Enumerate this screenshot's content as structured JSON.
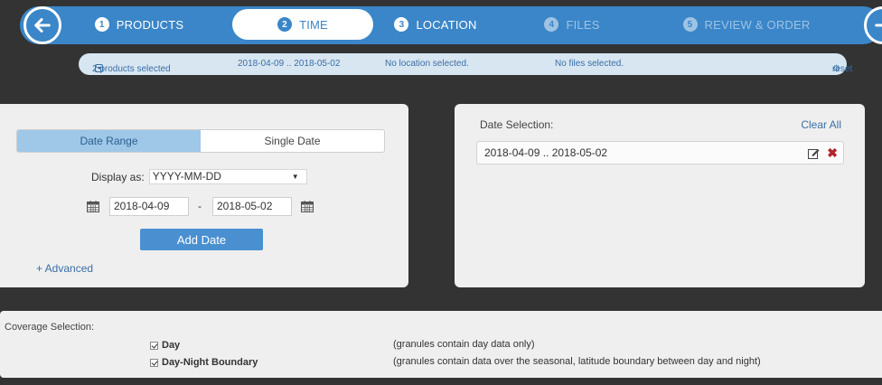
{
  "wizard": {
    "steps": [
      {
        "num": "1",
        "label": "PRODUCTS"
      },
      {
        "num": "2",
        "label": "TIME"
      },
      {
        "num": "3",
        "label": "LOCATION"
      },
      {
        "num": "4",
        "label": "FILES"
      },
      {
        "num": "5",
        "label": "REVIEW & ORDER"
      }
    ],
    "back_icon": "arrow-left-icon",
    "next_icon": "arrow-right-icon",
    "accent": "#3a86c8"
  },
  "summary": {
    "products": "2 products selected",
    "time": "2018-04-09 .. 2018-05-02",
    "location": "No location selected.",
    "files": "No files selected.",
    "reset": "reset"
  },
  "date_panel": {
    "tab_range": "Date Range",
    "tab_single": "Single Date",
    "display_label": "Display as:",
    "display_value": "YYYY-MM-DD",
    "start_date": "2018-04-09",
    "separator": "-",
    "end_date": "2018-05-02",
    "add_button": "Add Date",
    "advanced": "+ Advanced"
  },
  "selection_panel": {
    "label": "Date Selection:",
    "clear_all": "Clear All",
    "items": [
      "2018-04-09 .. 2018-05-02"
    ]
  },
  "coverage": {
    "title": "Coverage Selection:",
    "options": [
      {
        "label": "Day",
        "checked": true,
        "description": "(granules contain day data only)"
      },
      {
        "label": "Day-Night Boundary",
        "checked": true,
        "description": "(granules contain data over the seasonal, latitude boundary between day and night)"
      }
    ]
  }
}
